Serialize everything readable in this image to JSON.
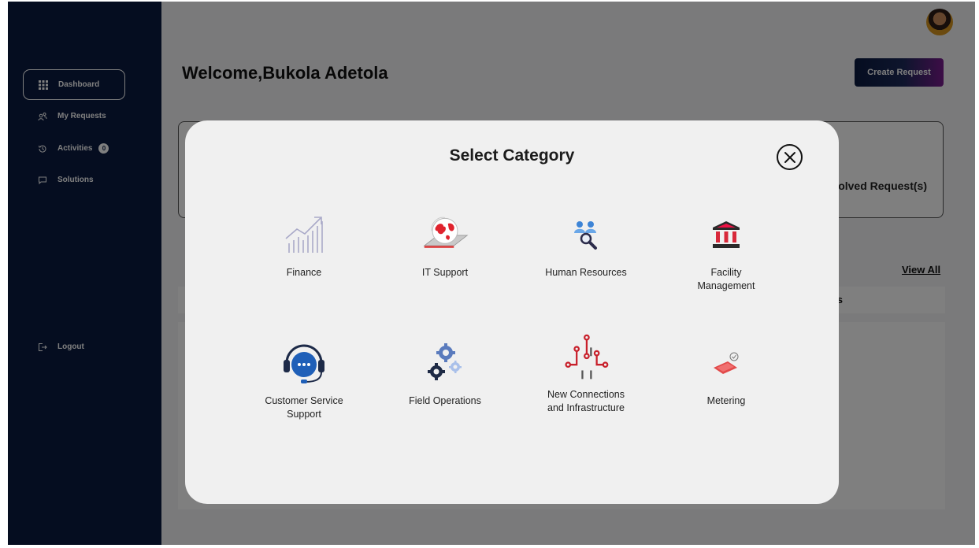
{
  "sidebar": {
    "items": [
      {
        "label": "Dashboard",
        "icon": "grid-icon"
      },
      {
        "label": "My Requests",
        "icon": "users-icon"
      },
      {
        "label": "Activities",
        "icon": "history-icon",
        "badge": "0"
      },
      {
        "label": "Solutions",
        "icon": "chat-icon"
      }
    ],
    "logout": {
      "label": "Logout",
      "icon": "logout-icon"
    }
  },
  "header": {
    "welcome": "Welcome,Bukola Adetola",
    "create_request": "Create Request"
  },
  "stats": {
    "resolved_label": "olved Request(s)"
  },
  "requests": {
    "view_all": "View All",
    "column_fragment": "s"
  },
  "modal": {
    "title": "Select Category",
    "categories": [
      {
        "label": "Finance",
        "icon": "finance-chart-icon"
      },
      {
        "label": "IT Support",
        "icon": "it-support-globe-icon"
      },
      {
        "label": "Human Resources",
        "icon": "human-resources-icon"
      },
      {
        "label": "Facility\nManagement",
        "icon": "facility-bank-icon"
      },
      {
        "label": "Customer Service\nSupport",
        "icon": "headset-icon"
      },
      {
        "label": "Field Operations",
        "icon": "gears-icon"
      },
      {
        "label": "New Connections\nand Infrastructure",
        "icon": "circuit-icon"
      },
      {
        "label": "Metering",
        "icon": "meter-card-icon"
      }
    ]
  },
  "colors": {
    "sidebar_bg": "#0a1a40",
    "accent_gradient_end": "#7a1b8e",
    "modal_bg": "#f0f0f0"
  }
}
